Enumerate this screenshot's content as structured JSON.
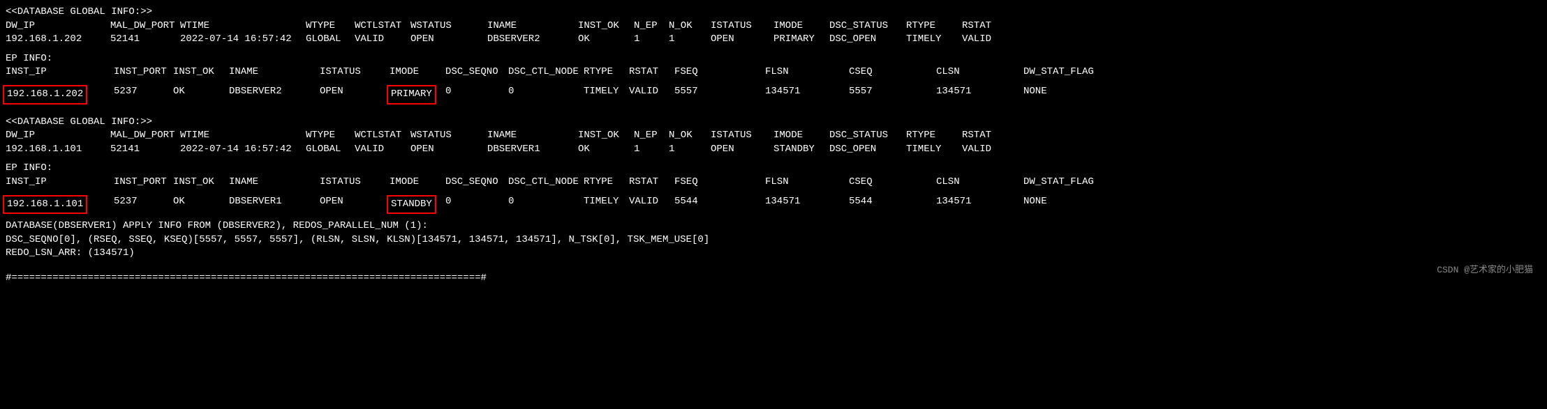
{
  "section1": {
    "title": "<<DATABASE GLOBAL INFO:>>",
    "headers": {
      "dw_ip": "DW_IP",
      "mal": "MAL_DW_PORT",
      "wtime": "WTIME",
      "wtype": "WTYPE",
      "wctl": "WCTLSTAT",
      "wstatus": "WSTATUS",
      "iname": "INAME",
      "instok": "INST_OK",
      "nep": "N_EP",
      "nok": "N_OK",
      "istatus": "ISTATUS",
      "imode": "IMODE",
      "dsc": "DSC_STATUS",
      "rtype": "RTYPE",
      "rstat": "RSTAT"
    },
    "values": {
      "dw_ip": "192.168.1.202",
      "mal": "52141",
      "wtime": "2022-07-14 16:57:42",
      "wtype": "GLOBAL",
      "wctl": "VALID",
      "wstatus": "OPEN",
      "iname": "DBSERVER2",
      "instok": "OK",
      "nep": "1",
      "nok": "1",
      "istatus": "OPEN",
      "imode": "PRIMARY",
      "dsc": "DSC_OPEN",
      "rtype": "TIMELY",
      "rstat": "VALID"
    }
  },
  "ep1": {
    "title": "EP INFO:",
    "headers": {
      "instip": "INST_IP",
      "instport": "INST_PORT",
      "instok": "INST_OK",
      "iname": "INAME",
      "istatus": "ISTATUS",
      "imode": "IMODE",
      "dscseq": "DSC_SEQNO",
      "dscctl": "DSC_CTL_NODE",
      "rtype": "RTYPE",
      "rstat": "RSTAT",
      "fseq": "FSEQ",
      "flsn": "FLSN",
      "cseq": "CSEQ",
      "clsn": "CLSN",
      "dwstat": "DW_STAT_FLAG"
    },
    "values": {
      "instip": "192.168.1.202",
      "instport": "5237",
      "instok": "OK",
      "iname": "DBSERVER2",
      "istatus": "OPEN",
      "imode": "PRIMARY",
      "dscseq": "0",
      "dscctl": "0",
      "rtype": "TIMELY",
      "rstat": "VALID",
      "fseq": "5557",
      "flsn": "134571",
      "cseq": "5557",
      "clsn": "134571",
      "dwstat": "NONE"
    }
  },
  "section2": {
    "title": "<<DATABASE GLOBAL INFO:>>",
    "values": {
      "dw_ip": "192.168.1.101",
      "mal": "52141",
      "wtime": "2022-07-14 16:57:42",
      "wtype": "GLOBAL",
      "wctl": "VALID",
      "wstatus": "OPEN",
      "iname": "DBSERVER1",
      "instok": "OK",
      "nep": "1",
      "nok": "1",
      "istatus": "OPEN",
      "imode": "STANDBY",
      "dsc": "DSC_OPEN",
      "rtype": "TIMELY",
      "rstat": "VALID"
    }
  },
  "ep2": {
    "title": "EP INFO:",
    "values": {
      "instip": "192.168.1.101",
      "instport": "5237",
      "instok": "OK",
      "iname": "DBSERVER1",
      "istatus": "OPEN",
      "imode": "STANDBY",
      "dscseq": "0",
      "dscctl": "0",
      "rtype": "TIMELY",
      "rstat": "VALID",
      "fseq": "5544",
      "flsn": "134571",
      "cseq": "5544",
      "clsn": "134571",
      "dwstat": "NONE"
    }
  },
  "apply": {
    "line1": "DATABASE(DBSERVER1) APPLY INFO FROM (DBSERVER2), REDOS_PARALLEL_NUM (1):",
    "line2": "DSC_SEQNO[0], (RSEQ, SSEQ, KSEQ)[5557, 5557, 5557], (RLSN, SLSN, KLSN)[134571, 134571, 134571], N_TSK[0], TSK_MEM_USE[0]",
    "line3": "REDO_LSN_ARR: (134571)"
  },
  "divider": "#================================================================================#",
  "watermark": "CSDN @艺术家的小肥猫"
}
